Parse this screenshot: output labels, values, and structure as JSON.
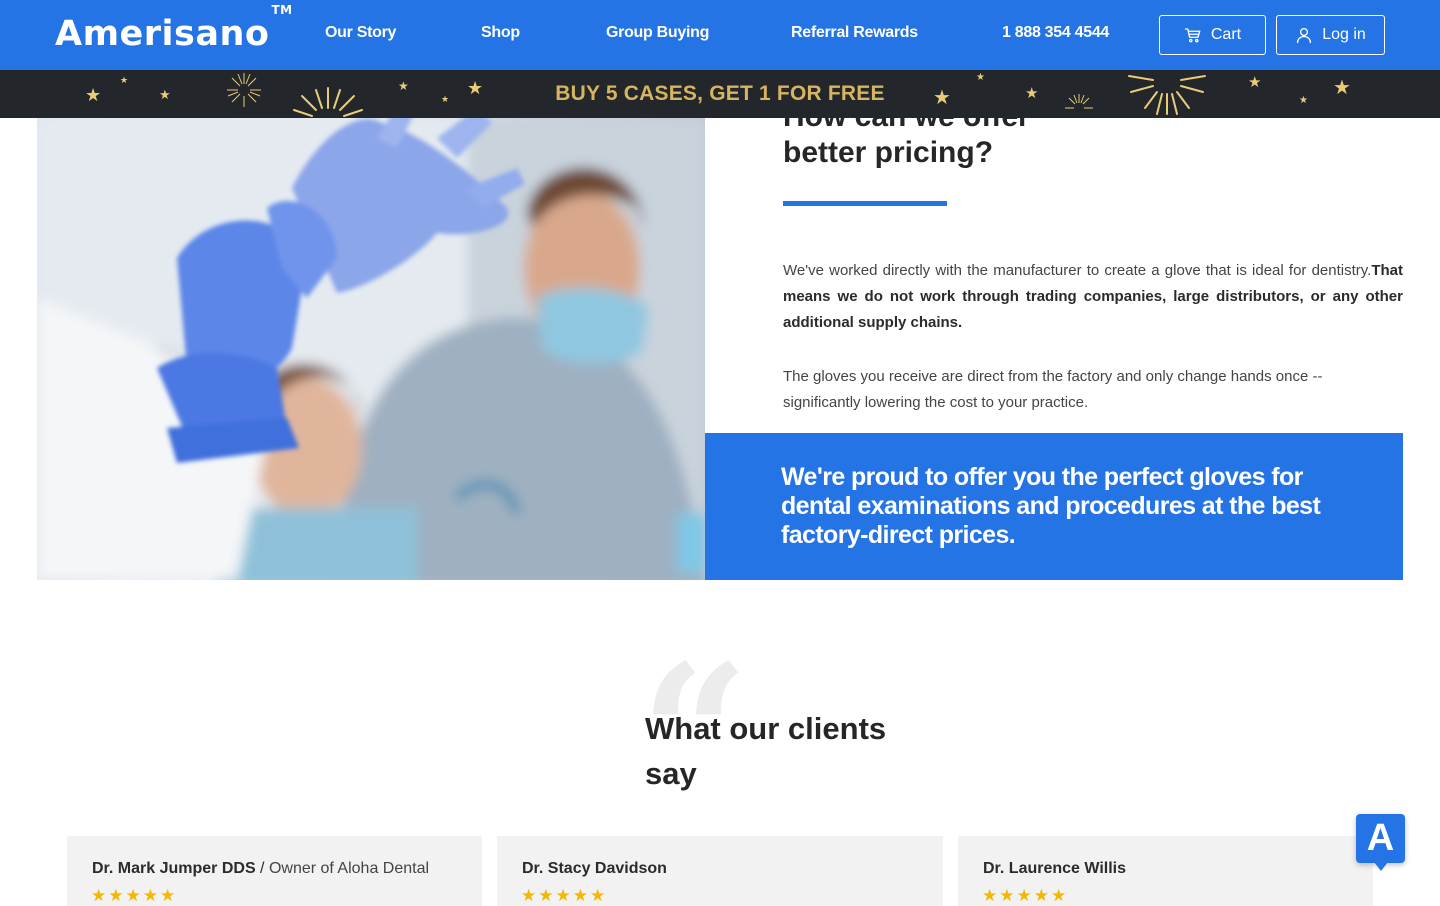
{
  "header": {
    "logo": "Amerisano",
    "logo_tm": "TM",
    "nav": [
      "Our Story",
      "Shop",
      "Group Buying",
      "Referral Rewards",
      "1 888 354 4544"
    ],
    "cart_label": "Cart",
    "login_label": "Log in"
  },
  "promo": {
    "text": "BUY 5 CASES, GET 1 FOR FREE"
  },
  "hero": {
    "heading_clipped": "How can we offer",
    "heading": "better pricing?",
    "para1_plain": "We've worked directly with the manufacturer to create a glove that is ideal for dentistry.",
    "para1_bold": "That means we do not work through trading companies, large distributors, or any other additional supply chains.",
    "para2": "The gloves you receive are direct from the factory and only change hands once -- significantly lowering the cost to your practice.",
    "callout": "We're proud to offer you the perfect gloves for dental examinations and procedures at the best factory-direct prices."
  },
  "testimonials": {
    "quote_glyph": "“",
    "title": "What our clients say",
    "cards": [
      {
        "name": "Dr. Mark Jumper DDS",
        "separator": " / ",
        "role": "Owner of Aloha Dental",
        "stars": "★★★★★"
      },
      {
        "name": "Dr. Stacy Davidson",
        "separator": "",
        "role": "",
        "stars": "★★★★★"
      },
      {
        "name": "Dr. Laurence Willis",
        "separator": "",
        "role": "",
        "stars": "★★★★★"
      }
    ]
  },
  "chat_widget": {
    "letter": "A"
  },
  "colors": {
    "brand_blue": "#2474e5",
    "promo_bg": "#23262b",
    "promo_gold": "#d6b460",
    "star_yellow": "#f5b800"
  }
}
